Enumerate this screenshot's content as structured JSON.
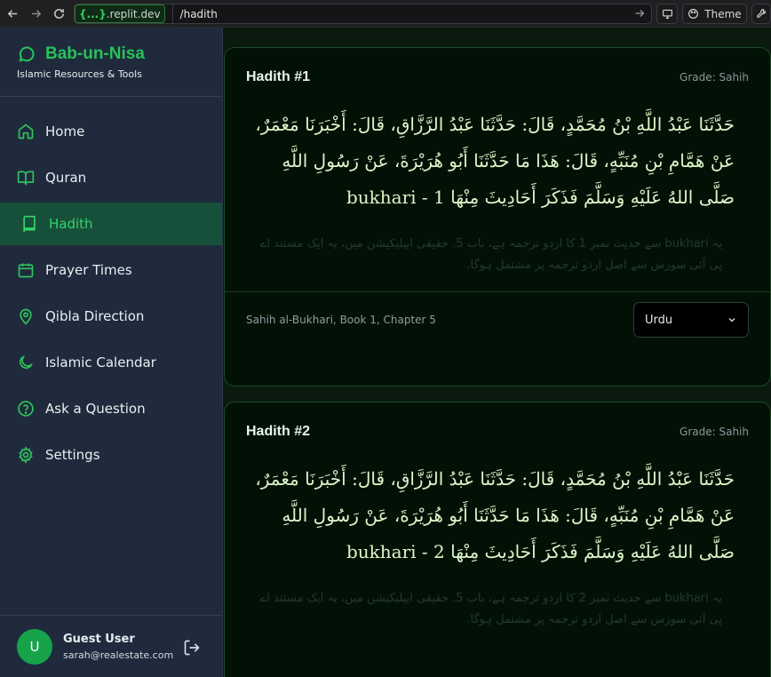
{
  "browser": {
    "domain_brace": "{...}",
    "domain": ".replit.dev",
    "path": "/hadith",
    "theme_label": "Theme"
  },
  "sidebar": {
    "brand_title": "Bab-un-Nisa",
    "brand_subtitle": "Islamic Resources & Tools",
    "items": [
      {
        "label": "Home",
        "icon": "home-icon"
      },
      {
        "label": "Quran",
        "icon": "book-open-icon"
      },
      {
        "label": "Hadith",
        "icon": "book-icon",
        "active": true
      },
      {
        "label": "Prayer Times",
        "icon": "calendar-icon"
      },
      {
        "label": "Qibla Direction",
        "icon": "map-pin-icon"
      },
      {
        "label": "Islamic Calendar",
        "icon": "moon-icon"
      },
      {
        "label": "Ask a Question",
        "icon": "help-circle-icon"
      },
      {
        "label": "Settings",
        "icon": "gear-icon"
      }
    ],
    "user": {
      "initial": "U",
      "name": "Guest User",
      "email": "sarah@realestate.com"
    }
  },
  "hadiths": [
    {
      "title": "Hadith #1",
      "grade": "Grade: Sahih",
      "arabic": "حَدَّثَنَا عَبْدُ اللَّهِ بْنُ مُحَمَّدٍ، قَالَ: حَدَّثَنَا عَبْدُ الرَّزَّاقِ، قَالَ: أَخْبَرَنَا مَعْمَرٌ، عَنْ هَمَّامِ بْنِ مُنَبِّهٍ، قَالَ: هَذَا مَا حَدَّثَنَا أَبُو هُرَيْرَةَ، عَنْ رَسُولِ اللَّهِ صَلَّى اللهُ عَلَيْهِ وَسَلَّمَ فَذَكَرَ أَحَادِيثَ مِنْهَا 1 - bukhari",
      "urdu": "یہ bukhari سے حدیث نمبر 1 کا اردو ترجمہ ہے، باب 5. حقیقی ایپلیکیشن میں، یہ ایک مستند اے پی آئی سورس سے اصل اردو ترجمہ پر مشتمل ہوگا.",
      "source": "Sahih al-Bukhari, Book 1, Chapter 5",
      "language": "Urdu"
    },
    {
      "title": "Hadith #2",
      "grade": "Grade: Sahih",
      "arabic": "حَدَّثَنَا عَبْدُ اللَّهِ بْنُ مُحَمَّدٍ، قَالَ: حَدَّثَنَا عَبْدُ الرَّزَّاقِ، قَالَ: أَخْبَرَنَا مَعْمَرٌ، عَنْ هَمَّامِ بْنِ مُنَبِّهٍ، قَالَ: هَذَا مَا حَدَّثَنَا أَبُو هُرَيْرَةَ، عَنْ رَسُولِ اللَّهِ صَلَّى اللهُ عَلَيْهِ وَسَلَّمَ فَذَكَرَ أَحَادِيثَ مِنْهَا 2 - bukhari",
      "urdu": "یہ bukhari سے حدیث نمبر 2 کا اردو ترجمہ ہے، باب 5. حقیقی ایپلیکیشن میں، یہ ایک مستند اے پی آئی سورس سے اصل اردو ترجمہ پر مشتمل ہوگا."
    }
  ],
  "colors": {
    "accent": "#27c25a",
    "sidebar_bg": "#1f2b3c",
    "active_bg": "#17503a",
    "card_bg": "#021106",
    "card_border": "#1b4a26"
  }
}
